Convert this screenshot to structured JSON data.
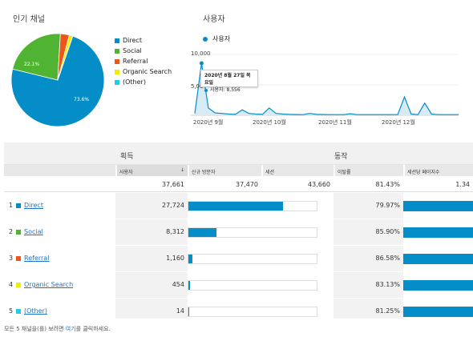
{
  "pie": {
    "title": "인기 채널",
    "label_large": "73.6%",
    "label_social": "22.1%"
  },
  "legend": [
    {
      "label": "Direct",
      "color": "#058dc7"
    },
    {
      "label": "Social",
      "color": "#50b432"
    },
    {
      "label": "Referral",
      "color": "#ed561b"
    },
    {
      "label": "Organic Search",
      "color": "#edef00"
    },
    {
      "label": "(Other)",
      "color": "#24cbe5"
    }
  ],
  "line": {
    "title": "사용자",
    "series_name": "사용자",
    "y_top_label": "10,000",
    "y_mid_label": "5,00",
    "x_labels": [
      "2020년 9월",
      "2020년 10월",
      "2020년 11월",
      "2020년 12월"
    ],
    "tooltip_date": "2020년 8월 27일 목요일",
    "tooltip_value": "사용자: 8,556"
  },
  "chart_data": [
    {
      "type": "pie",
      "title": "인기 채널",
      "categories": [
        "Direct",
        "Social",
        "Referral",
        "Organic Search",
        "(Other)"
      ],
      "values": [
        73.6,
        22.1,
        3.1,
        1.2,
        0.04
      ]
    },
    {
      "type": "line",
      "title": "사용자",
      "series": [
        {
          "name": "사용자",
          "values": [
            300,
            8556,
            1200,
            400,
            300,
            200,
            150,
            900,
            300,
            200,
            150,
            1200,
            300,
            200,
            150,
            120,
            100,
            300,
            150,
            120,
            100,
            100,
            100,
            250,
            100,
            100,
            100,
            100,
            100,
            100,
            100,
            3000,
            200,
            100,
            2000,
            200,
            100,
            100,
            100,
            100
          ]
        }
      ],
      "x_tick_labels": [
        "2020년 9월",
        "2020년 10월",
        "2020년 11월",
        "2020년 12월"
      ],
      "ylim": [
        0,
        10000
      ]
    }
  ],
  "table": {
    "group_acquisition": "획득",
    "group_behavior": "동작",
    "headers": {
      "users": "사용자",
      "sort_icon": "↓",
      "new_users": "신규 방문자",
      "sessions": "세션",
      "bounce": "이탈률",
      "pages_per_session": "세션당 페이지수"
    },
    "totals": {
      "users": "37,661",
      "new_users": "37,470",
      "sessions": "43,660",
      "bounce": "81.43%",
      "pages_per_session": "1.34"
    },
    "rows": [
      {
        "idx": "1",
        "name": "Direct",
        "color": "#058dc7",
        "users": "27,724",
        "share": 0.736,
        "bounce": "79.97%"
      },
      {
        "idx": "2",
        "name": "Social",
        "color": "#50b432",
        "users": "8,312",
        "share": 0.221,
        "bounce": "85.90%"
      },
      {
        "idx": "3",
        "name": "Referral",
        "color": "#ed561b",
        "users": "1,160",
        "share": 0.031,
        "bounce": "86.58%"
      },
      {
        "idx": "4",
        "name": "Organic Search",
        "color": "#edef00",
        "users": "454",
        "share": 0.012,
        "bounce": "83.13%"
      },
      {
        "idx": "5",
        "name": "(Other)",
        "color": "#24cbe5",
        "users": "14",
        "share": 0.0004,
        "bounce": "81.25%"
      }
    ]
  },
  "footer": {
    "prefix": "모든 5 채널을(를) 보려면 ",
    "link": "여기",
    "suffix": "를 클릭하세요."
  }
}
